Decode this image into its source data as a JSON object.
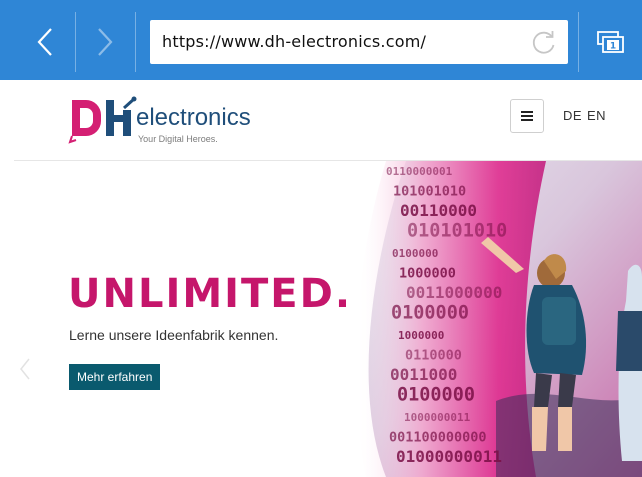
{
  "browser": {
    "url": "https://www.dh-electronics.com/",
    "accent": "#2f86d6",
    "tab_count": "1"
  },
  "site": {
    "logo_word": "electronics",
    "logo_letters": "DH",
    "tagline": "Your Digital Heroes.",
    "lang_de": "DE",
    "lang_en": "EN"
  },
  "hero": {
    "title": "UNLIMITED.",
    "subtitle": "Lerne unsere Ideenfabrik kennen.",
    "cta_label": "Mehr erfahren",
    "binary_lines": [
      "0110000001",
      "101001010",
      "00110000",
      "010101010",
      "0100000",
      "1000000",
      "0011000000",
      "0100000",
      "1000000",
      "0110000",
      "0011000",
      "0100000",
      "1000000011",
      "001100000000",
      "01000000011"
    ],
    "colors": {
      "title": "#c5166b",
      "cta": "#0a5a6e",
      "magenta": "#e0248a"
    }
  }
}
